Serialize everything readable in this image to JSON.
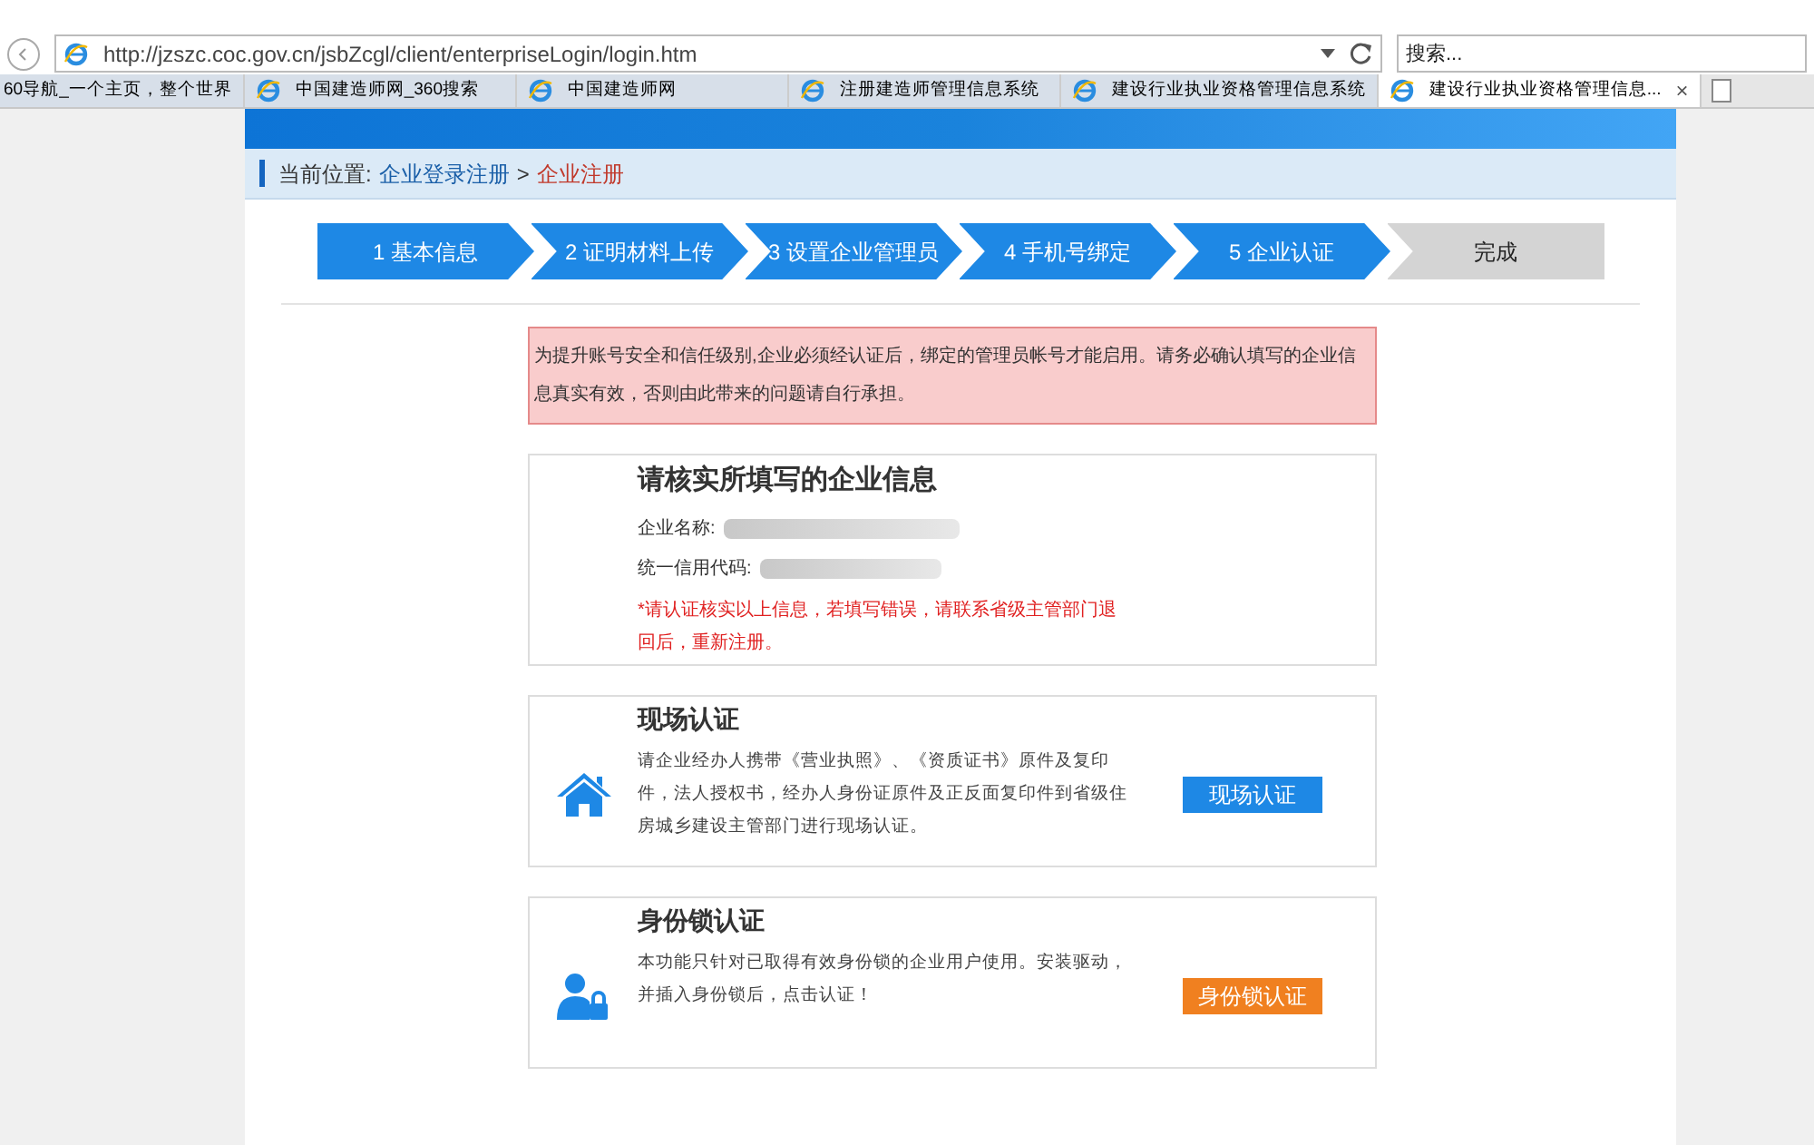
{
  "browser": {
    "url": "http://jzszc.coc.gov.cn/jsbZcgl/client/enterpriseLogin/login.htm",
    "search_placeholder": "搜索...",
    "tabs": [
      {
        "label": "60导航_一个主页，整个世界",
        "selected": false
      },
      {
        "label": "中国建造师网_360搜索",
        "selected": false
      },
      {
        "label": "中国建造师网",
        "selected": false
      },
      {
        "label": "注册建造师管理信息系统",
        "selected": false
      },
      {
        "label": "建设行业执业资格管理信息系统",
        "selected": false
      },
      {
        "label": "建设行业执业资格管理信息...",
        "selected": true
      }
    ],
    "close_tab": "×"
  },
  "breadcrumb": {
    "label": "当前位置:",
    "items": [
      {
        "label": "企业登录注册",
        "selected": false
      },
      {
        "label": "企业注册",
        "selected": true
      }
    ],
    "separator": ">"
  },
  "steps": [
    {
      "label": "1 基本信息",
      "done": true
    },
    {
      "label": "2 证明材料上传",
      "done": true
    },
    {
      "label": "3 设置企业管理员",
      "done": true
    },
    {
      "label": "4 手机号绑定",
      "done": true
    },
    {
      "label": "5 企业认证",
      "done": true
    },
    {
      "label": "完成",
      "done": false
    }
  ],
  "alert": "为提升账号安全和信任级别,企业必须经认证后，绑定的管理员帐号才能启用。请务必确认填写的企业信息真实有效，否则由此带来的问题请自行承担。",
  "info_card": {
    "title": "请核实所填写的企业信息",
    "fields": [
      {
        "label": "企业名称:"
      },
      {
        "label": "统一信用代码:"
      }
    ],
    "note": "*请认证核实以上信息，若填写错误，请联系省级主管部门退回后，重新注册。"
  },
  "auth_cards": [
    {
      "kind": "onsite",
      "title": "现场认证",
      "text": "请企业经办人携带《营业执照》、《资质证书》原件及复印件，法人授权书，经办人身份证原件及正反面复印件到省级住房城乡建设主管部门进行现场认证。",
      "button": "现场认证"
    },
    {
      "kind": "key",
      "title": "身份锁认证",
      "text": "本功能只针对已取得有效身份锁的企业用户使用。安装驱动，并插入身份锁后，点击认证！",
      "button": "身份锁认证"
    }
  ]
}
